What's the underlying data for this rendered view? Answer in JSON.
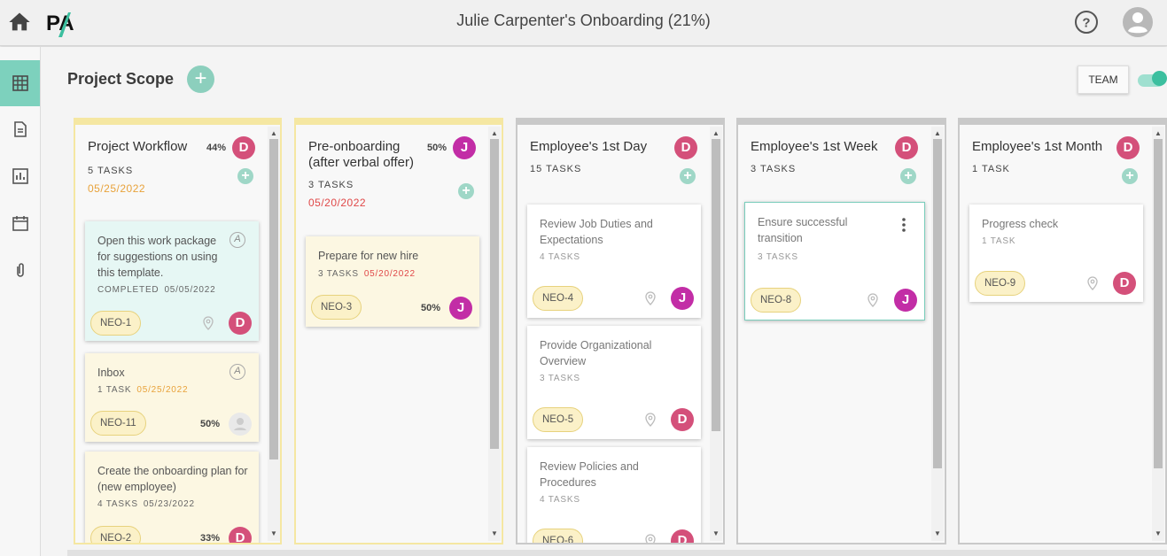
{
  "header": {
    "title": "Julie Carpenter's Onboarding (21%)",
    "logo_text": "PA",
    "accent": "#3cbf9f"
  },
  "sidebar": {
    "items": [
      {
        "icon": "grid-icon",
        "active": true
      },
      {
        "icon": "document-icon",
        "active": false
      },
      {
        "icon": "report-icon",
        "active": false
      },
      {
        "icon": "calendar-icon",
        "active": false
      },
      {
        "icon": "paperclip-icon",
        "active": false
      }
    ]
  },
  "page": {
    "title": "Project Scope",
    "add_label": "+",
    "team_label": "TEAM",
    "team_toggle_on": true
  },
  "columns": [
    {
      "title": "Project Workflow",
      "pct": "44%",
      "avatar": "D",
      "count": "5 TASKS",
      "date": "05/25/2022",
      "cards": [
        {
          "title": "Open this work package for suggestions on using this template.",
          "meta": "COMPLETED",
          "meta_date": "05/05/2022",
          "chip": "NEO-1",
          "avatar": "D"
        },
        {
          "title": "Inbox",
          "meta": "1 TASK",
          "meta_date": "05/25/2022",
          "chip": "NEO-11",
          "pct": "50%"
        },
        {
          "title": "Create the onboarding plan for (new employee)",
          "meta": "4 TASKS",
          "meta_date": "05/23/2022",
          "chip": "NEO-2",
          "pct": "33%",
          "avatar": "D"
        }
      ]
    },
    {
      "title": "Pre-onboarding (after verbal offer)",
      "pct": "50%",
      "avatar": "J",
      "count": "3 TASKS",
      "date": "05/20/2022",
      "cards": [
        {
          "title": "Prepare for new hire",
          "meta": "3 TASKS",
          "meta_date": "05/20/2022",
          "chip": "NEO-3",
          "pct": "50%",
          "avatar": "J"
        }
      ]
    },
    {
      "title": "Employee's 1st Day",
      "avatar": "D",
      "count": "15 TASKS",
      "cards": [
        {
          "title": "Review Job Duties and Expectations",
          "meta": "4 TASKS",
          "chip": "NEO-4",
          "avatar": "J"
        },
        {
          "title": "Provide Organizational Overview",
          "meta": "3 TASKS",
          "chip": "NEO-5",
          "avatar": "D"
        },
        {
          "title": "Review Policies and Procedures",
          "meta": "4 TASKS",
          "chip": "NEO-6",
          "avatar": "D"
        }
      ]
    },
    {
      "title": "Employee's 1st Week",
      "avatar": "D",
      "count": "3 TASKS",
      "cards": [
        {
          "title": "Ensure successful transition",
          "meta": "3 TASKS",
          "chip": "NEO-8",
          "avatar": "J"
        }
      ]
    },
    {
      "title": "Employee's 1st Month",
      "avatar": "D",
      "count": "1 TASK",
      "cards": [
        {
          "title": "Progress check",
          "meta": "1 TASK",
          "chip": "NEO-9",
          "avatar": "D"
        }
      ]
    }
  ]
}
